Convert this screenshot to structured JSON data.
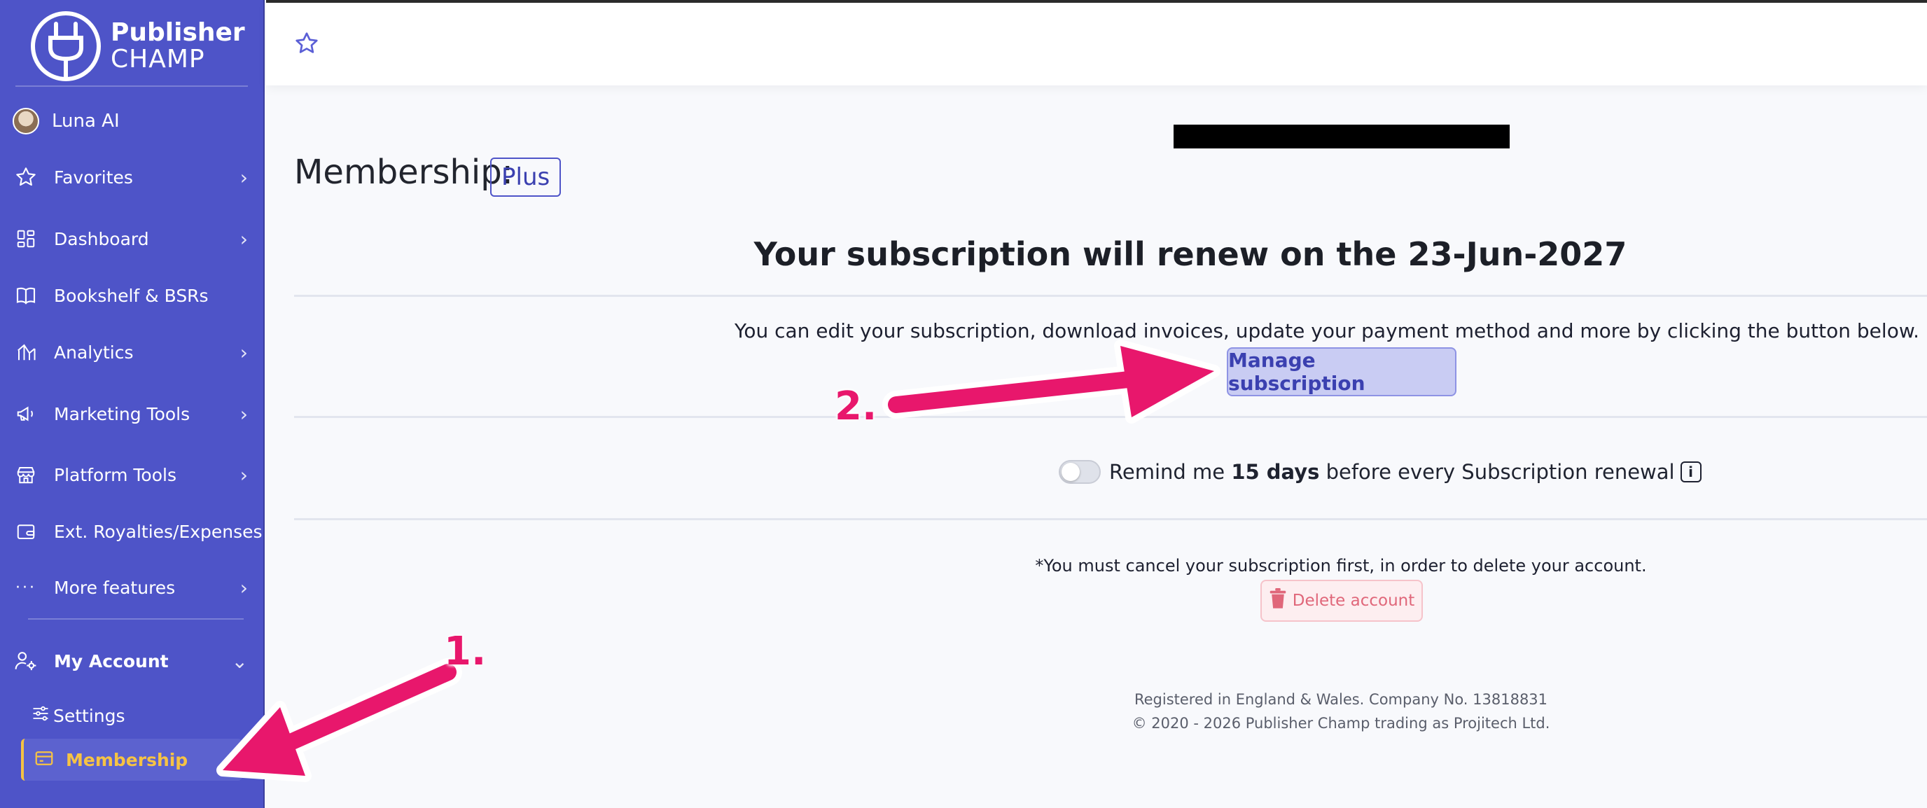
{
  "brand": {
    "line1": "Publisher",
    "line2": "CHAMP"
  },
  "user": {
    "name": "Luna AI"
  },
  "sidebar": {
    "items": [
      {
        "label": "Favorites",
        "icon": "star-icon",
        "chevron": "›"
      },
      {
        "label": "Dashboard",
        "icon": "grid-icon",
        "chevron": "›"
      },
      {
        "label": "Bookshelf & BSRs",
        "icon": "book-icon"
      },
      {
        "label": "Analytics",
        "icon": "analytics-icon",
        "chevron": "›"
      },
      {
        "label": "Marketing Tools",
        "icon": "megaphone-icon",
        "chevron": "›"
      },
      {
        "label": "Platform Tools",
        "icon": "store-icon",
        "chevron": "›"
      },
      {
        "label": "Ext. Royalties/Expenses",
        "icon": "wallet-icon"
      },
      {
        "label": "More features",
        "icon": "dots-icon",
        "chevron": "›"
      }
    ],
    "account": {
      "label": "My Account",
      "chevron": "⌄"
    },
    "settings": {
      "label": "Settings"
    },
    "membership": {
      "label": "Membership"
    }
  },
  "main": {
    "title": "Membership:",
    "plan": "Plus",
    "renew_text": "Your subscription will renew on the 23-Jun-2027",
    "edit_text": "You can edit your subscription, download invoices, update your payment method and more by clicking the button below.",
    "manage_button": "Manage subscription",
    "remind": {
      "pre": "Remind me ",
      "days": "15 days",
      "post": " before every Subscription renewal"
    },
    "info_glyph": "i",
    "cancel_note": "*You must cancel your subscription first, in order to delete your account.",
    "delete_button": "Delete account",
    "footer_line1": "Registered in England & Wales. Company No. 13818831",
    "footer_line2": "© 2020 - 2026 Publisher Champ trading as Projitech Ltd."
  },
  "annotations": {
    "step1": "1.",
    "step2": "2."
  },
  "colors": {
    "sidebar": "#4e54c8",
    "active": "#f6c344",
    "arrow": "#e8176c",
    "button": "#c9ccf3"
  }
}
